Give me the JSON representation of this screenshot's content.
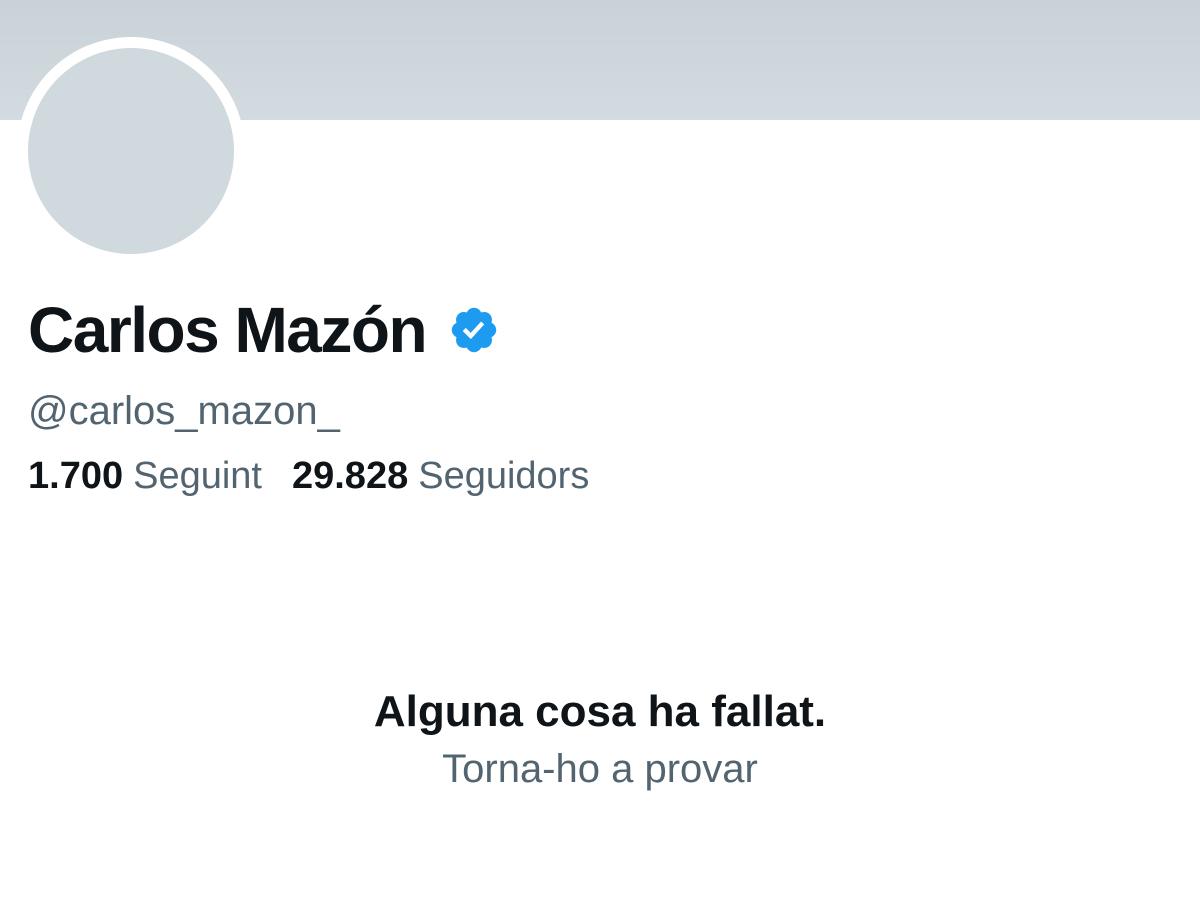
{
  "profile": {
    "display_name": "Carlos Mazón",
    "handle": "@carlos_mazon_",
    "verified_icon": "verified-badge-icon",
    "accent_color": "#1d9bf0"
  },
  "stats": {
    "following_count": "1.700",
    "following_label": "Seguint",
    "followers_count": "29.828",
    "followers_label": "Seguidors"
  },
  "error": {
    "title": "Alguna cosa ha fallat.",
    "retry_label": "Torna-ho a provar"
  }
}
